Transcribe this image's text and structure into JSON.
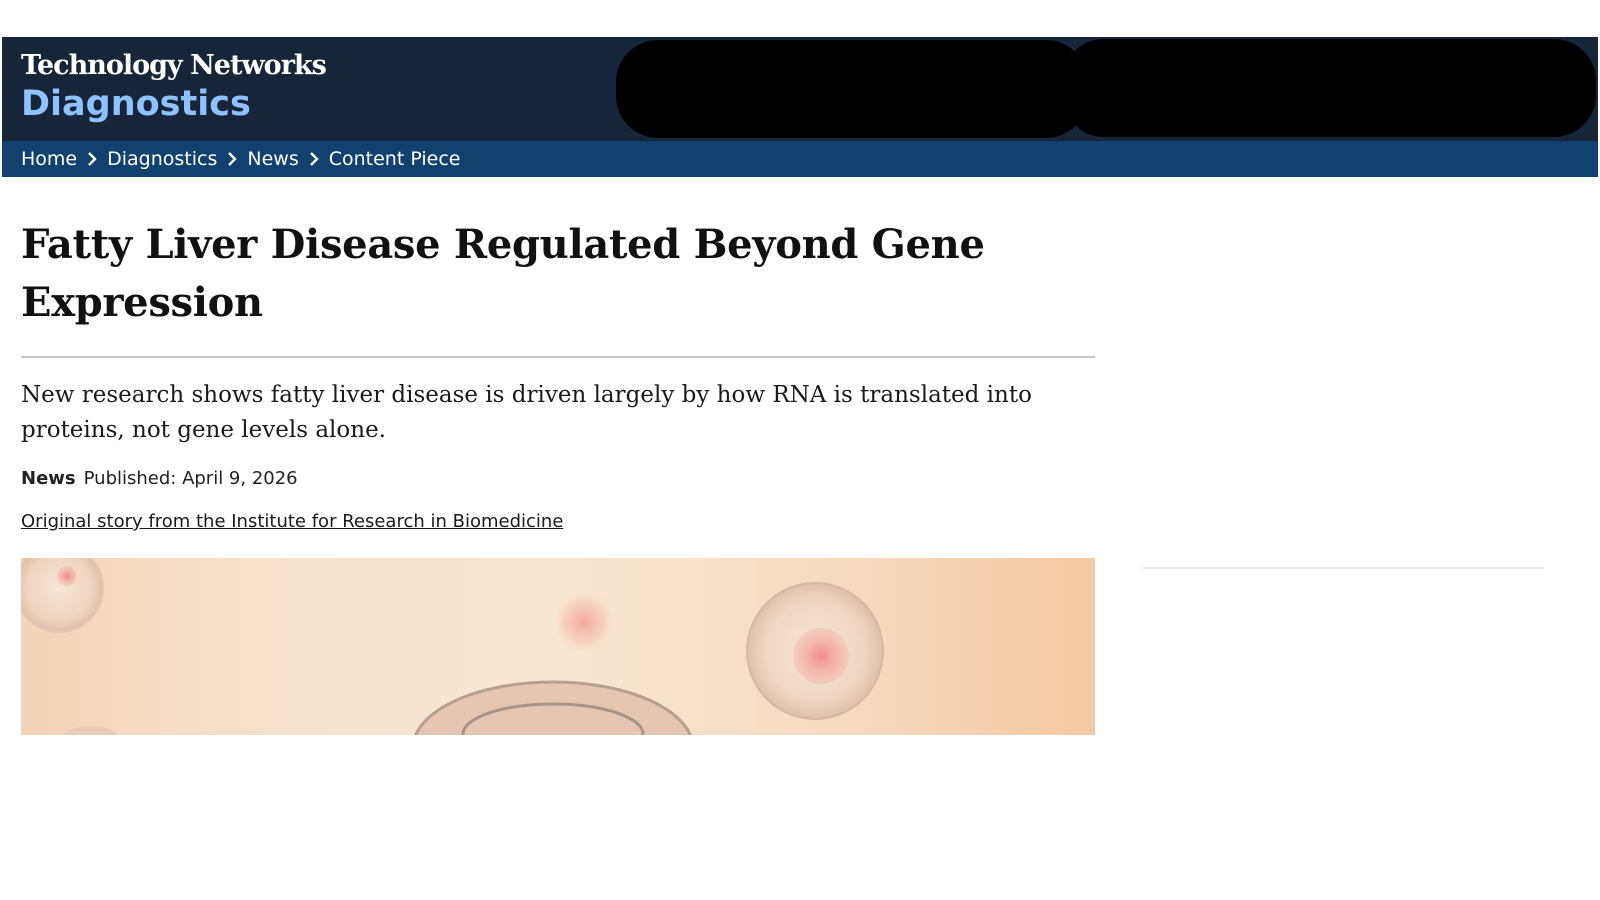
{
  "header": {
    "brand_name": "Technology Networks",
    "brand_section": "Diagnostics",
    "background": "#16253a",
    "section_color": "#8fc3ff"
  },
  "breadcrumb": {
    "items": [
      "Home",
      "Diagnostics",
      "News",
      "Content Piece"
    ],
    "background": "#12406f"
  },
  "article": {
    "title": "Fatty Liver Disease Regulated Beyond Gene Expression",
    "standfirst": "New research shows fatty liver disease is driven largely by how RNA is translated into proteins, not gene levels alone.",
    "type": "News",
    "published": "Published: April 9, 2026",
    "source_link": "Original story from the Institute for Research in Biomedicine"
  }
}
